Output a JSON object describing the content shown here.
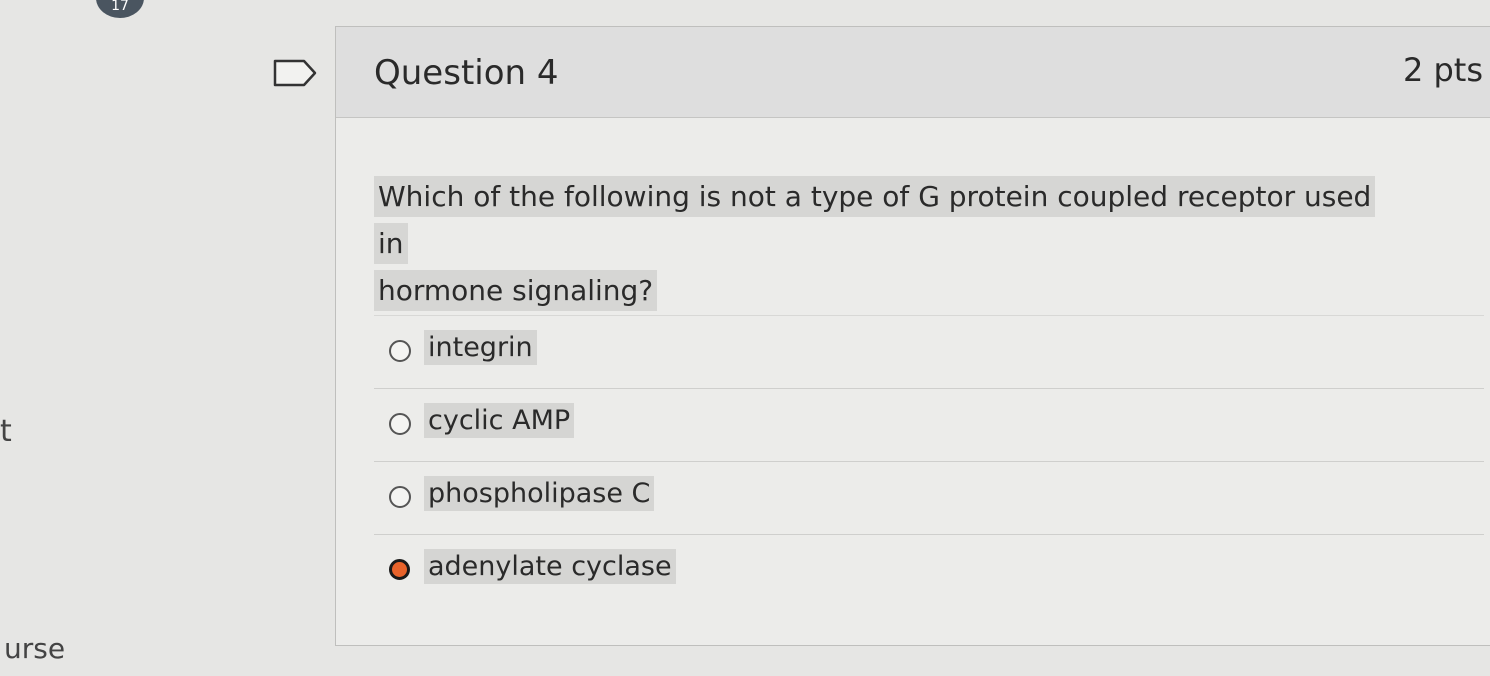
{
  "page": {
    "badge_count": "17",
    "side_text_1": "t",
    "side_text_2": "urse"
  },
  "question": {
    "title": "Question 4",
    "points": "2 pts",
    "text_line_1": "Which of the following is not a type of G protein coupled receptor used in",
    "text_line_2": "hormone signaling?",
    "answers": [
      {
        "label": "integrin",
        "selected": false
      },
      {
        "label": "cyclic AMP",
        "selected": false
      },
      {
        "label": "phospholipase C",
        "selected": false
      },
      {
        "label": "adenylate cyclase",
        "selected": true
      }
    ]
  },
  "colors": {
    "selected_radio": "#e8632b",
    "header_bg": "#dedede"
  },
  "icons": {
    "flag": "flag-question-icon"
  }
}
